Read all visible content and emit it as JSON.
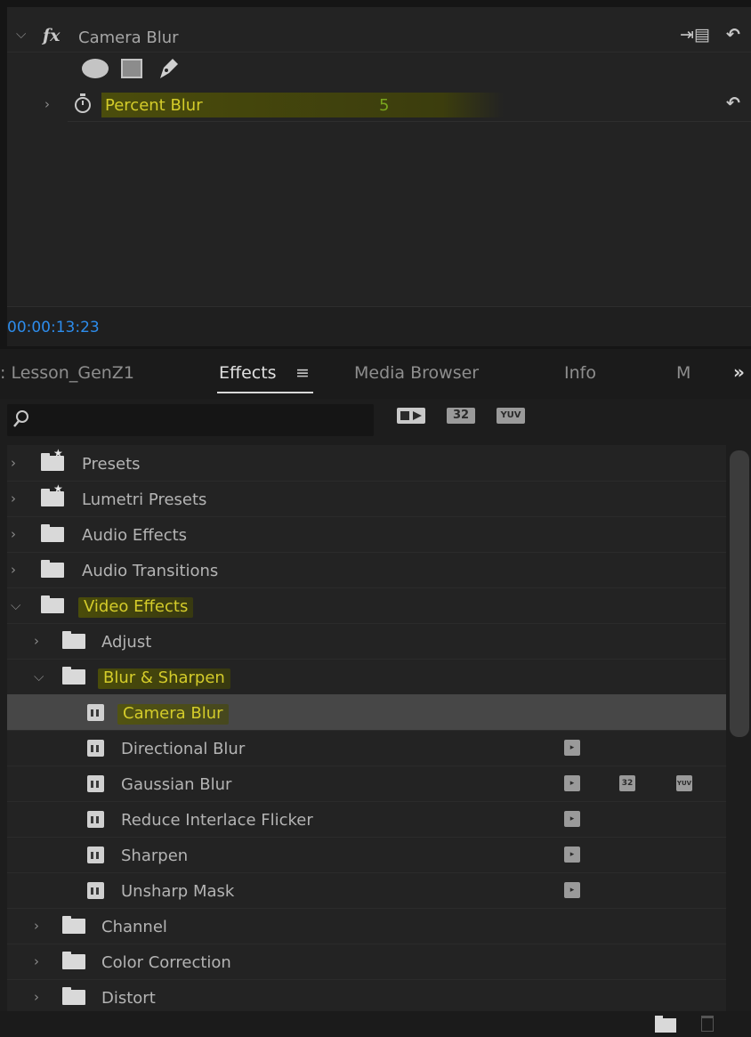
{
  "effect_controls": {
    "effect_name": "Camera Blur",
    "fx_symbol": "fx",
    "param_name": "Percent Blur",
    "param_value": "5",
    "timecode": "00:00:13:23",
    "icons": [
      "chevron-down-icon",
      "fx-icon",
      "ellipse-mask-icon",
      "rectangle-mask-icon",
      "pen-mask-icon",
      "chevron-right-icon",
      "stopwatch-icon",
      "reset-icon",
      "export-preset-icon"
    ]
  },
  "effects_panel": {
    "tabs": [
      {
        "label": ": Lesson_GenZ1",
        "active": false
      },
      {
        "label": "Effects",
        "active": true
      },
      {
        "label": "Media Browser",
        "active": false
      },
      {
        "label": "Info",
        "active": false
      },
      {
        "label": "M",
        "active": false
      }
    ],
    "menu_glyph": "≡",
    "more_glyph": "»",
    "search": {
      "value": "",
      "placeholder": ""
    },
    "filter_badges": [
      "accelerated",
      "32",
      "YUV"
    ],
    "tree": [
      {
        "label": "Presets",
        "level": 0,
        "type": "preset-folder",
        "expanded": false
      },
      {
        "label": "Lumetri Presets",
        "level": 0,
        "type": "preset-folder",
        "expanded": false
      },
      {
        "label": "Audio Effects",
        "level": 0,
        "type": "folder",
        "expanded": false
      },
      {
        "label": "Audio Transitions",
        "level": 0,
        "type": "folder",
        "expanded": false
      },
      {
        "label": "Video Effects",
        "level": 0,
        "type": "folder",
        "expanded": true,
        "highlighted": true
      },
      {
        "label": "Adjust",
        "level": 1,
        "type": "folder",
        "expanded": false
      },
      {
        "label": "Blur & Sharpen",
        "level": 1,
        "type": "folder",
        "expanded": true,
        "highlighted": true
      },
      {
        "label": "Camera Blur",
        "level": 2,
        "type": "effect",
        "selected": true,
        "highlighted": true,
        "badges": []
      },
      {
        "label": "Directional Blur",
        "level": 2,
        "type": "effect",
        "badges": [
          "accelerated"
        ]
      },
      {
        "label": "Gaussian Blur",
        "level": 2,
        "type": "effect",
        "badges": [
          "accelerated",
          "32",
          "YUV"
        ]
      },
      {
        "label": "Reduce Interlace Flicker",
        "level": 2,
        "type": "effect",
        "badges": [
          "accelerated"
        ]
      },
      {
        "label": "Sharpen",
        "level": 2,
        "type": "effect",
        "badges": [
          "accelerated"
        ]
      },
      {
        "label": "Unsharp Mask",
        "level": 2,
        "type": "effect",
        "badges": [
          "accelerated"
        ]
      },
      {
        "label": "Channel",
        "level": 1,
        "type": "folder",
        "expanded": false
      },
      {
        "label": "Color Correction",
        "level": 1,
        "type": "folder",
        "expanded": false
      },
      {
        "label": "Distort",
        "level": 1,
        "type": "folder",
        "expanded": false
      }
    ]
  },
  "colors": {
    "highlight_bg": "#585a04",
    "highlight_text": "#d4cc2a",
    "value_green": "#79a61e",
    "timecode_blue": "#2d8ceb",
    "panel_bg": "#232323"
  }
}
